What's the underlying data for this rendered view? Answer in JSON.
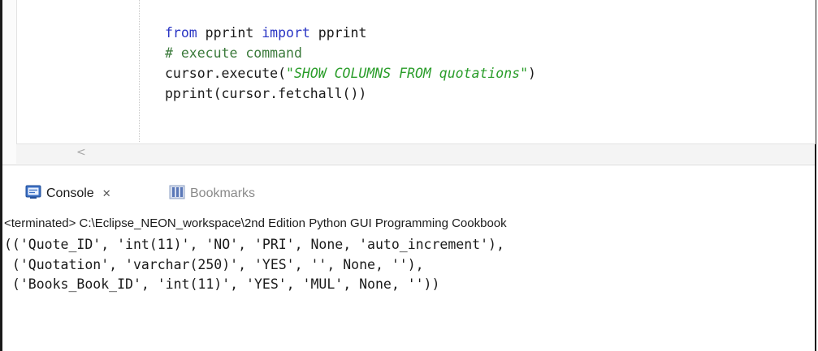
{
  "editor": {
    "code_lines": [
      {
        "kw1": "from",
        "t1": " pprint ",
        "kw2": "import",
        "t2": " pprint"
      },
      {
        "comment": "# execute command"
      },
      {
        "t1": "cursor.execute(",
        "str": "\"SHOW COLUMNS FROM quotations\"",
        "t2": ")"
      },
      {
        "t1": "pprint(cursor.fetchall())"
      }
    ],
    "scroll_left_glyph": "<"
  },
  "tabs": {
    "console_label": "Console",
    "console_close": "✕",
    "bookmarks_label": "Bookmarks"
  },
  "console": {
    "status_line": "<terminated> C:\\Eclipse_NEON_workspace\\2nd Edition Python GUI Programming Cookbook",
    "output_lines": [
      "(('Quote_ID', 'int(11)', 'NO', 'PRI', None, 'auto_increment'),",
      " ('Quotation', 'varchar(250)', 'YES', '', None, ''),",
      " ('Books_Book_ID', 'int(11)', 'YES', 'MUL', None, ''))"
    ]
  },
  "icons": {
    "console": "console-icon",
    "bookmarks": "bookmarks-icon"
  },
  "colors": {
    "keyword": "#2a35c4",
    "comment": "#3b7a3b",
    "string": "#2a9d2a"
  }
}
